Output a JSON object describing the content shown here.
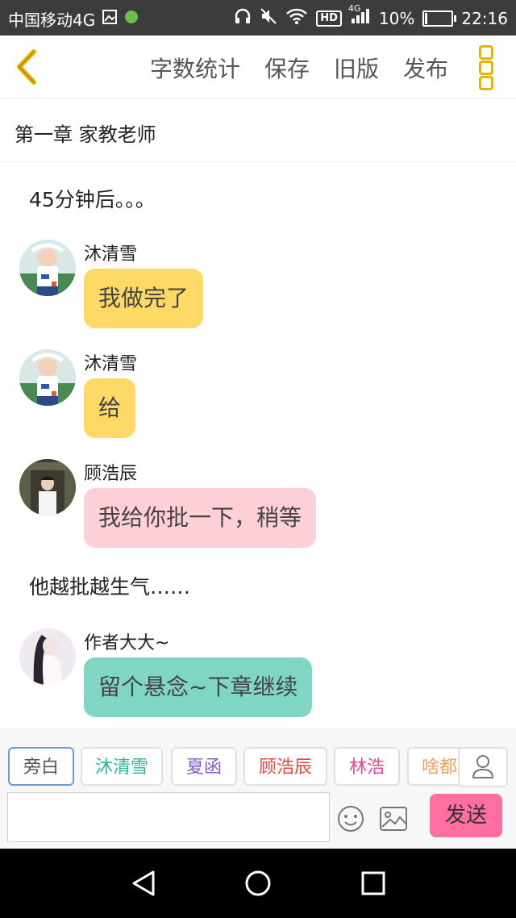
{
  "status_bar": {
    "carrier": "中国移动4G",
    "hd": "HD",
    "network": "4G",
    "battery": "10%",
    "battery_level": 0.1,
    "time": "22:16"
  },
  "toolbar": {
    "actions": [
      "字数统计",
      "保存",
      "旧版",
      "发布"
    ]
  },
  "chapter": {
    "title": "第一章 家教老师"
  },
  "chat": {
    "narration_1": "45分钟后。。。",
    "messages": [
      {
        "sender": "沐清雪",
        "text": "我做完了",
        "color": "#ffd966"
      },
      {
        "sender": "沐清雪",
        "text": "给",
        "color": "#ffd966"
      },
      {
        "sender": "顾浩辰",
        "text": "我给你批一下，稍等",
        "color": "#ffd0d8"
      }
    ],
    "narration_2": "他越批越生气……",
    "last_message": {
      "sender": "作者大大~",
      "text": "留个悬念~下章继续",
      "color": "#7fd6c4"
    }
  },
  "characters": [
    {
      "name": "旁白",
      "color": "#555555"
    },
    {
      "name": "沐清雪",
      "color": "#2bb5a0"
    },
    {
      "name": "夏函",
      "color": "#8a5cc8"
    },
    {
      "name": "顾浩辰",
      "color": "#e04a3c"
    },
    {
      "name": "林浩",
      "color": "#e04a8c"
    },
    {
      "name": "啥都",
      "color": "#f0a060"
    }
  ],
  "input": {
    "placeholder": ""
  },
  "send_label": "发送",
  "colors": {
    "accent": "#e8b400",
    "send": "#ff6ea0",
    "active_chip": "#6a9bd8"
  },
  "icons": [
    "back-chevron-icon",
    "more-menu-icon",
    "person-icon",
    "emoji-icon",
    "image-icon",
    "back-triangle-icon",
    "home-circle-icon",
    "recents-square-icon"
  ]
}
